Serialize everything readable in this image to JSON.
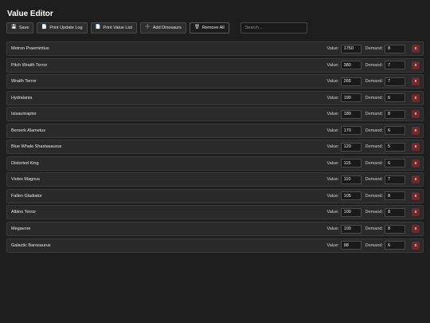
{
  "title": "Value Editor",
  "toolbar": {
    "save": {
      "label": "Save",
      "icon": "💾"
    },
    "print_update_log": {
      "label": "Print Update Log",
      "icon": "📄"
    },
    "print_value_list": {
      "label": "Print Value List",
      "icon": "📄"
    },
    "add_dinosaurs": {
      "label": "Add Dinosaurs",
      "icon": "➕"
    },
    "remove_all": {
      "label": "Remove All",
      "icon": "🗑"
    },
    "search_placeholder": "Search..."
  },
  "labels": {
    "value": "Value:",
    "demand": "Demand:",
    "delete": "x"
  },
  "rows": [
    {
      "name": "Metron Praemintius",
      "value": "1750",
      "demand": "8"
    },
    {
      "name": "Pitch Wraith Terror",
      "value": "380",
      "demand": "7"
    },
    {
      "name": "Wraith Terror",
      "value": "265",
      "demand": "7"
    },
    {
      "name": "Hydralania",
      "value": "190",
      "demand": "6"
    },
    {
      "name": "Isisauriraptor",
      "value": "180",
      "demand": "8"
    },
    {
      "name": "Berserk Alametus",
      "value": "170",
      "demand": "6"
    },
    {
      "name": "Blue Whale Shastasaurus",
      "value": "120",
      "demand": "5"
    },
    {
      "name": "Distorted King",
      "value": "115",
      "demand": "6"
    },
    {
      "name": "Violex Magnus",
      "value": "110",
      "demand": "7"
    },
    {
      "name": "Fallen Gladiator",
      "value": "105",
      "demand": "8"
    },
    {
      "name": "Albino Terror",
      "value": "100",
      "demand": "8"
    },
    {
      "name": "Megavore",
      "value": "100",
      "demand": "8"
    },
    {
      "name": "Galactic Barosaurus",
      "value": "98",
      "demand": "6"
    }
  ]
}
